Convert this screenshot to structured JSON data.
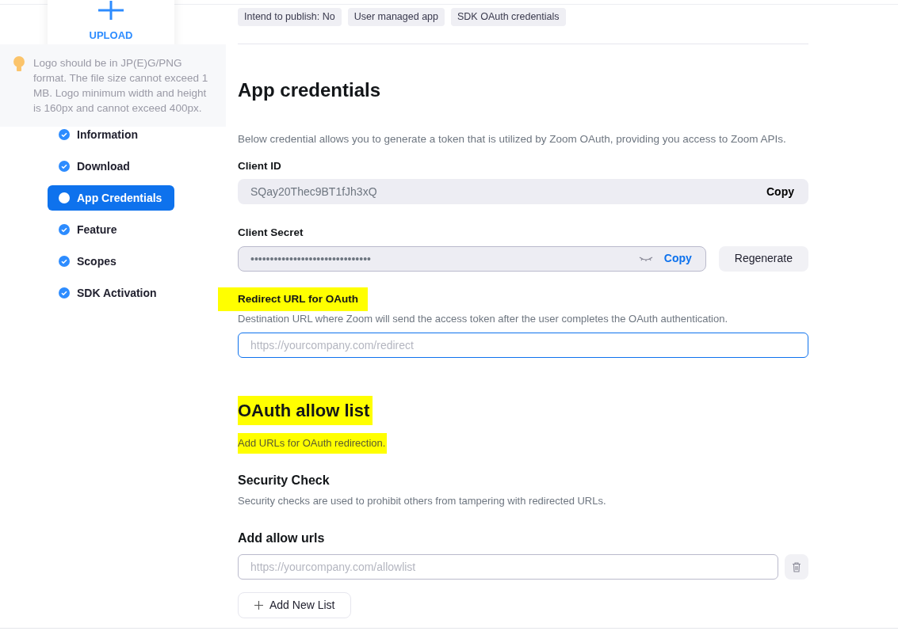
{
  "upload": {
    "label": "UPLOAD"
  },
  "logo_hint": "Logo should be in JP(E)G/PNG format. The file size cannot exceed 1 MB. Logo minimum width and height is 160px and cannot exceed 400px.",
  "sidebar": {
    "items": [
      {
        "label": "Information",
        "selected": false,
        "done": true
      },
      {
        "label": "Download",
        "selected": false,
        "done": true
      },
      {
        "label": "App Credentials",
        "selected": true,
        "done": false
      },
      {
        "label": "Feature",
        "selected": false,
        "done": true
      },
      {
        "label": "Scopes",
        "selected": false,
        "done": true
      },
      {
        "label": "SDK Activation",
        "selected": false,
        "done": true
      }
    ]
  },
  "tags": [
    "Intend to publish: No",
    "User managed app",
    "SDK OAuth credentials"
  ],
  "credentials": {
    "title": "App credentials",
    "description": "Below credential allows you to generate a token that is utilized by Zoom OAuth, providing you access to Zoom APIs.",
    "client_id": {
      "label": "Client ID",
      "value": "SQay20Thec9BT1fJh3xQ",
      "copy": "Copy"
    },
    "client_secret": {
      "label": "Client Secret",
      "value": "•••••••••••••••••••••••••••••••",
      "copy": "Copy",
      "regenerate": "Regenerate"
    },
    "redirect": {
      "label": "Redirect URL for OAuth",
      "highlighted": true,
      "description": "Destination URL where Zoom will send the access token after the user completes the OAuth authentication.",
      "placeholder": "https://yourcompany.com/redirect",
      "focused": true
    }
  },
  "allow_list": {
    "title": "OAuth allow list",
    "title_highlighted": true,
    "description": "Add URLs for OAuth redirection.",
    "description_highlighted": true,
    "security_title": "Security Check",
    "security_description": "Security checks are used to prohibit others from tampering with redirected URLs.",
    "urls_label": "Add allow urls",
    "urls": [
      {
        "placeholder": "https://yourcompany.com/allowlist"
      }
    ],
    "add_button": "Add New List"
  }
}
